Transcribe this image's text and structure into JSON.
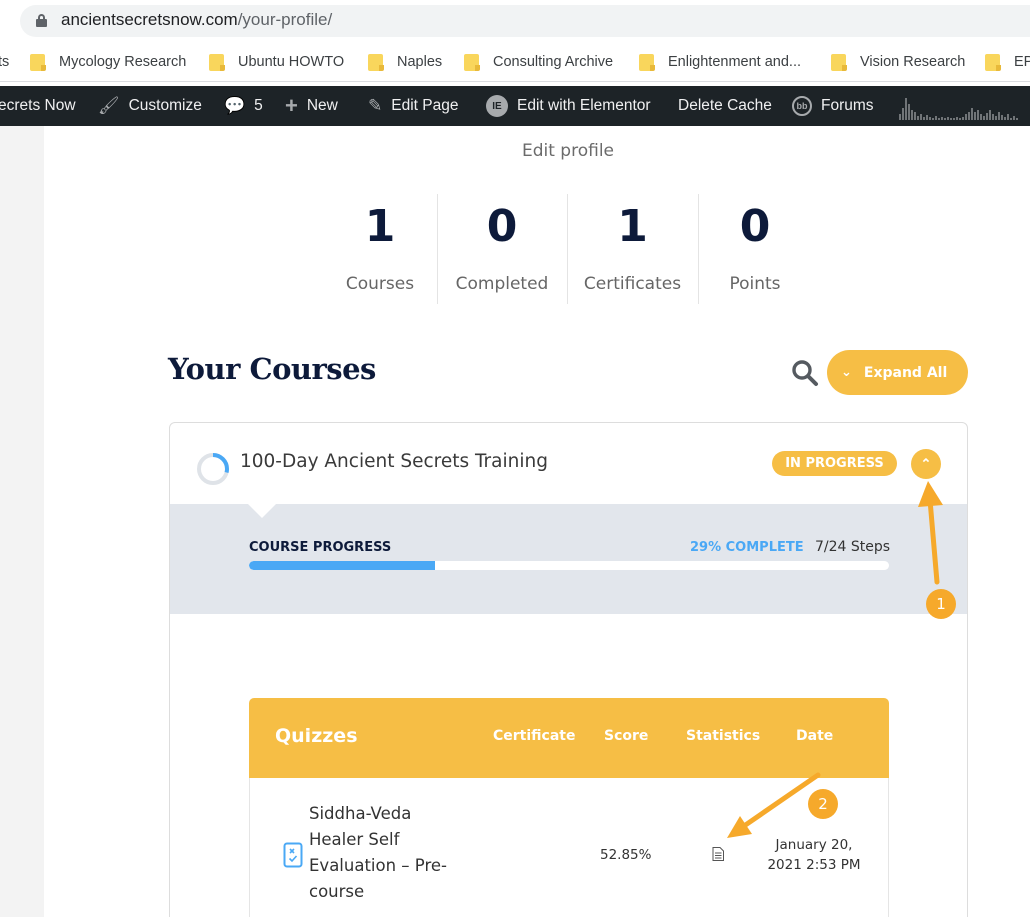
{
  "browser": {
    "url_host": "ancientsecretsnow.com",
    "url_path": "/your-profile/"
  },
  "bookmarks": [
    {
      "label": "ts"
    },
    {
      "label": "Mycology Research"
    },
    {
      "label": "Ubuntu HOWTO"
    },
    {
      "label": "Naples"
    },
    {
      "label": "Consulting Archive"
    },
    {
      "label": "Enlightenment and..."
    },
    {
      "label": "Vision Research"
    },
    {
      "label": "EP"
    }
  ],
  "adminbar": {
    "site": "ecrets Now",
    "customize": "Customize",
    "comments_count": "5",
    "new": "New",
    "edit_page": "Edit Page",
    "edit_elementor": "Edit with Elementor",
    "delete_cache": "Delete Cache",
    "forums": "Forums"
  },
  "profile": {
    "edit_link": "Edit profile",
    "stats": [
      {
        "value": "1",
        "label": "Courses"
      },
      {
        "value": "0",
        "label": "Completed"
      },
      {
        "value": "1",
        "label": "Certificates"
      },
      {
        "value": "0",
        "label": "Points"
      }
    ]
  },
  "courses_section": {
    "heading": "Your Courses",
    "expand_label": "Expand All"
  },
  "course": {
    "title": "100-Day Ancient Secrets Training",
    "status": "IN PROGRESS",
    "progress_label": "COURSE PROGRESS",
    "percent_text": "29% COMPLETE",
    "percent_value": 0.29,
    "steps_text": "7/24 Steps"
  },
  "quizzes": {
    "headers": {
      "title": "Quizzes",
      "certificate": "Certificate",
      "score": "Score",
      "statistics": "Statistics",
      "date": "Date"
    },
    "rows": [
      {
        "name": "Siddha-Veda Healer Self Evaluation – Pre-course",
        "score": "52.85%",
        "date": "January 20, 2021 2:53 PM"
      }
    ]
  },
  "annotations": [
    {
      "label": "1"
    },
    {
      "label": "2"
    }
  ],
  "colors": {
    "accent": "#f6be45",
    "progress": "#4aa8f5",
    "heading": "#0d1a3a",
    "adminbar": "#1d2327"
  }
}
